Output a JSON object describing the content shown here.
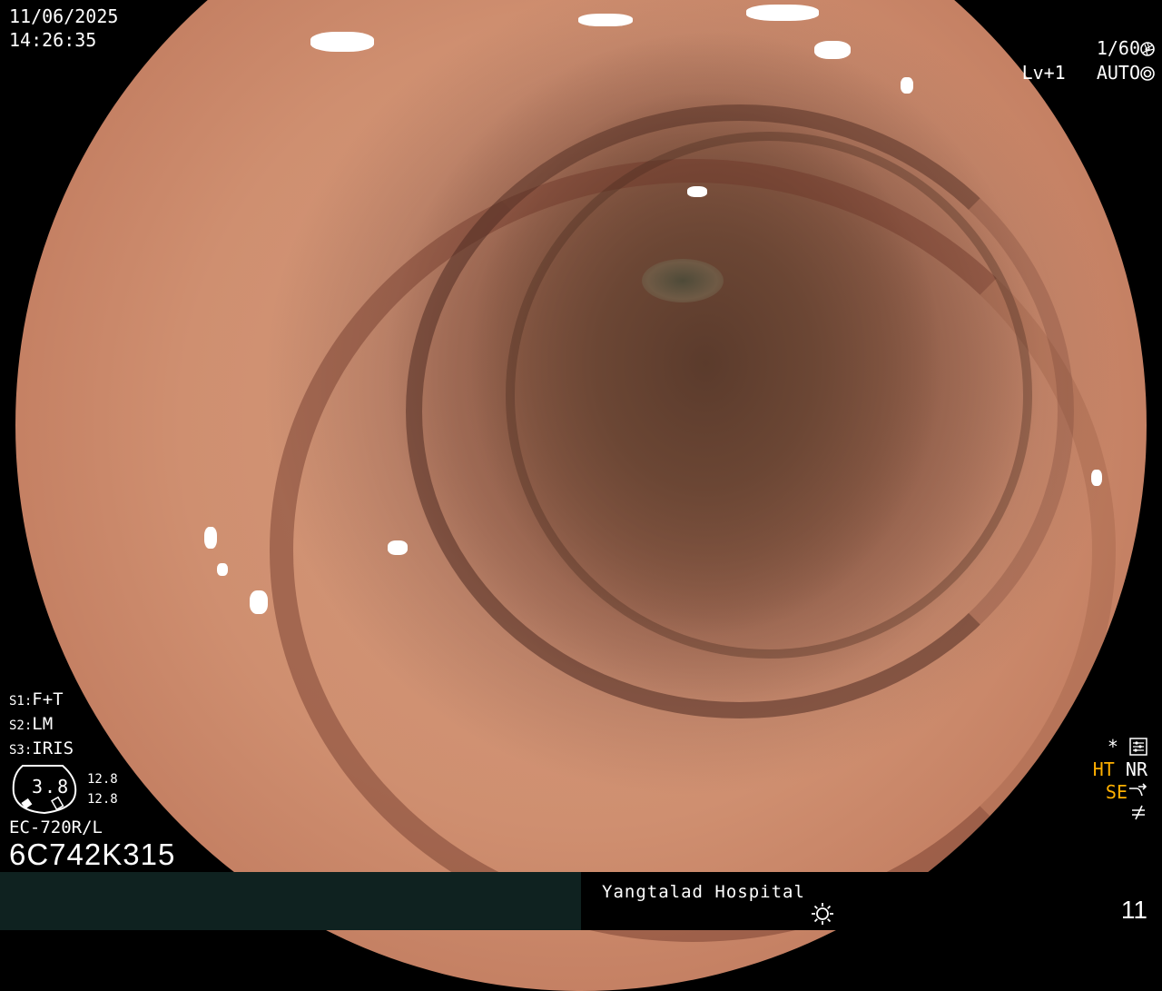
{
  "overlay": {
    "date": "11/06/2025",
    "time": "14:26:35",
    "shutter": "1/60",
    "level": "Lv+1",
    "mode": "AUTO",
    "settings": [
      {
        "label": "S1:",
        "value": "F+T"
      },
      {
        "label": "S2:",
        "value": "LM"
      },
      {
        "label": "S3:",
        "value": "IRIS"
      }
    ],
    "gauge": {
      "value": "3.8",
      "r1": "12.8",
      "r2": "12.8"
    },
    "model": "EC-720R/L",
    "serial": "6C742K315",
    "right_status": {
      "star": "*",
      "ht": "HT",
      "nr": "NR",
      "se": "SE"
    }
  },
  "status_bar": {
    "hospital": "Yangtalad Hospital",
    "frame_number": "11"
  },
  "colors": {
    "accent_orange": "#ffb000",
    "status_left_bg": "#0f2220",
    "mucosa": "#cf8f70"
  },
  "icons": [
    "shutter-icon",
    "auto-iris-icon",
    "settings-grid-icon",
    "se-curve-icon",
    "not-equal-icon",
    "sun-icon"
  ]
}
